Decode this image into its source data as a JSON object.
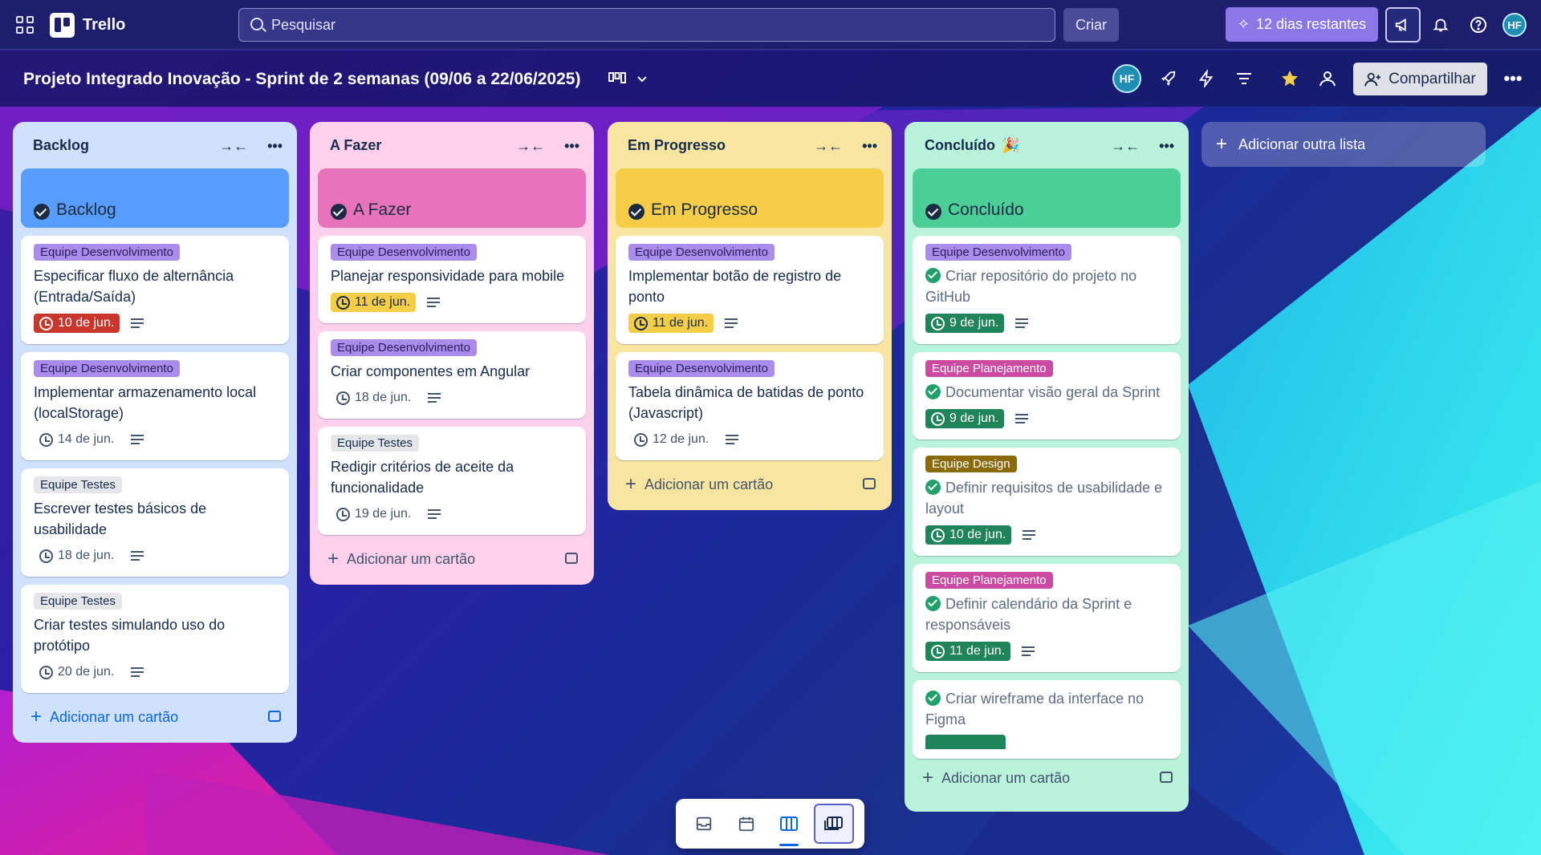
{
  "app": {
    "name": "Trello"
  },
  "topbar": {
    "search_placeholder": "Pesquisar",
    "create_label": "Criar",
    "trial_label": "12 dias restantes",
    "avatar_initials": "HF"
  },
  "board": {
    "title": "Projeto Integrado Inovação - Sprint de 2 semanas (09/06 a 22/06/2025)",
    "member_initials": "HF",
    "share_label": "Compartilhar"
  },
  "colors": {
    "backlog": "#cfe1fd",
    "backlog_status": "#579dff",
    "todo": "#fdd0ec",
    "todo_status": "#e774bb",
    "progress": "#f8e6a0",
    "progress_status": "#f5cd47",
    "done": "#baf3db",
    "done_status": "#4bce97"
  },
  "lists": [
    {
      "title": "Backlog",
      "status_title": "Backlog",
      "add_label": "Adicionar um cartão",
      "cards": [
        {
          "label": "Equipe Desenvolvimento",
          "title": "Especificar fluxo de alternância (Entrada/Saída)",
          "due": "10 de jun."
        },
        {
          "label": "Equipe Desenvolvimento",
          "title": "Implementar armazenamento local (localStorage)",
          "due": "14 de jun."
        },
        {
          "label": "Equipe Testes",
          "title": "Escrever testes básicos de usabilidade",
          "due": "18 de jun."
        },
        {
          "label": "Equipe Testes",
          "title": "Criar testes simulando uso do protótipo",
          "due": "20 de jun."
        }
      ]
    },
    {
      "title": "A Fazer",
      "status_title": "A Fazer",
      "add_label": "Adicionar um cartão",
      "cards": [
        {
          "label": "Equipe Desenvolvimento",
          "title": "Planejar responsividade para mobile",
          "due": "11 de jun."
        },
        {
          "label": "Equipe Desenvolvimento",
          "title": "Criar componentes em Angular",
          "due": "18 de jun."
        },
        {
          "label": "Equipe Testes",
          "title": "Redigir critérios de aceite da funcionalidade",
          "due": "19 de jun."
        }
      ]
    },
    {
      "title": "Em Progresso",
      "status_title": "Em Progresso",
      "add_label": "Adicionar um cartão",
      "cards": [
        {
          "label": "Equipe Desenvolvimento",
          "title": "Implementar botão de registro de ponto",
          "due": "11 de jun."
        },
        {
          "label": "Equipe Desenvolvimento",
          "title": "Tabela dinâmica de batidas de ponto (Javascript)",
          "due": "12 de jun."
        }
      ]
    },
    {
      "title": "Concluído",
      "status_title": "Concluído",
      "add_label": "Adicionar um cartão",
      "cards": [
        {
          "label": "Equipe Desenvolvimento",
          "title": "Criar repositório do projeto no GitHub",
          "due": "9 de jun."
        },
        {
          "label": "Equipe Planejamento",
          "title": "Documentar visão geral da Sprint",
          "due": "9 de jun."
        },
        {
          "label": "Equipe Design",
          "title": "Definir requisitos de usabilidade e layout",
          "due": "10 de jun."
        },
        {
          "label": "Equipe Planejamento",
          "title": "Definir calendário da Sprint e responsáveis",
          "due": "11 de jun."
        },
        {
          "title": "Criar wireframe da interface no Figma"
        }
      ]
    }
  ],
  "add_list_label": "Adicionar outra lista"
}
